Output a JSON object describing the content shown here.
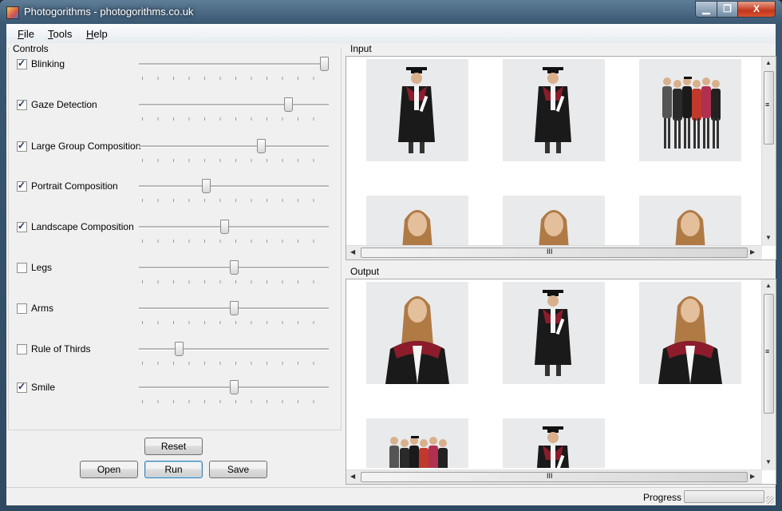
{
  "window": {
    "title": "Photogorithms - photogorithms.co.uk"
  },
  "caption": {
    "minimize": "▁",
    "maximize": "❐",
    "close": "X"
  },
  "menu": [
    {
      "label": "File",
      "mnemonic": "F",
      "rest": "ile"
    },
    {
      "label": "Tools",
      "mnemonic": "T",
      "rest": "ools"
    },
    {
      "label": "Help",
      "mnemonic": "H",
      "rest": "elp"
    }
  ],
  "controls": {
    "group_label": "Controls",
    "items": [
      {
        "label": "Blinking",
        "checked": true,
        "value": 1.0
      },
      {
        "label": "Gaze Detection",
        "checked": true,
        "value": 0.8
      },
      {
        "label": "Large Group Composition",
        "checked": true,
        "value": 0.65
      },
      {
        "label": "Portrait Composition",
        "checked": true,
        "value": 0.35
      },
      {
        "label": "Landscape Composition",
        "checked": true,
        "value": 0.45
      },
      {
        "label": "Legs",
        "checked": false,
        "value": 0.5
      },
      {
        "label": "Arms",
        "checked": false,
        "value": 0.5
      },
      {
        "label": "Rule of Thirds",
        "checked": false,
        "value": 0.2
      },
      {
        "label": "Smile",
        "checked": true,
        "value": 0.5
      }
    ]
  },
  "buttons": {
    "reset": "Reset",
    "open": "Open",
    "run": "Run",
    "save": "Save"
  },
  "input": {
    "group_label": "Input"
  },
  "output": {
    "group_label": "Output"
  },
  "scroll": {
    "grip": "≡",
    "hgrip": "III",
    "up": "▲",
    "down": "▼",
    "left": "◀",
    "right": "▶"
  },
  "status": {
    "progress_label": "Progress",
    "progress_value": 0
  },
  "colors": {
    "gown": "#1a1a1a",
    "hood": "#8c1c2b",
    "background": "#e9eaec"
  }
}
